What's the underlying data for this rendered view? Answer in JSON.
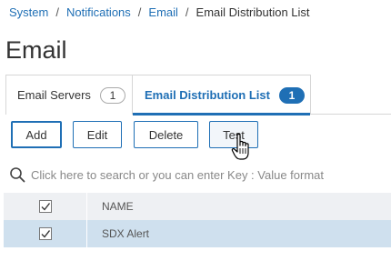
{
  "breadcrumb": {
    "items": [
      "System",
      "Notifications",
      "Email"
    ],
    "separator": "/",
    "current": "Email Distribution List"
  },
  "page": {
    "title": "Email"
  },
  "tabs": [
    {
      "label": "Email Servers",
      "count": "1",
      "active": false
    },
    {
      "label": "Email Distribution List",
      "count": "1",
      "active": true
    }
  ],
  "toolbar": {
    "add_label": "Add",
    "edit_label": "Edit",
    "delete_label": "Delete",
    "test_label": "Test"
  },
  "search": {
    "placeholder": "Click here to search or you can enter Key : Value format",
    "icon": "search-icon"
  },
  "table": {
    "columns": [
      "NAME"
    ],
    "rows": [
      {
        "name": "SDX Alert",
        "selected": true
      }
    ]
  },
  "colors": {
    "accent": "#1f6fb5",
    "selected_row": "#cfe0ee",
    "header_row": "#eef0f3"
  }
}
